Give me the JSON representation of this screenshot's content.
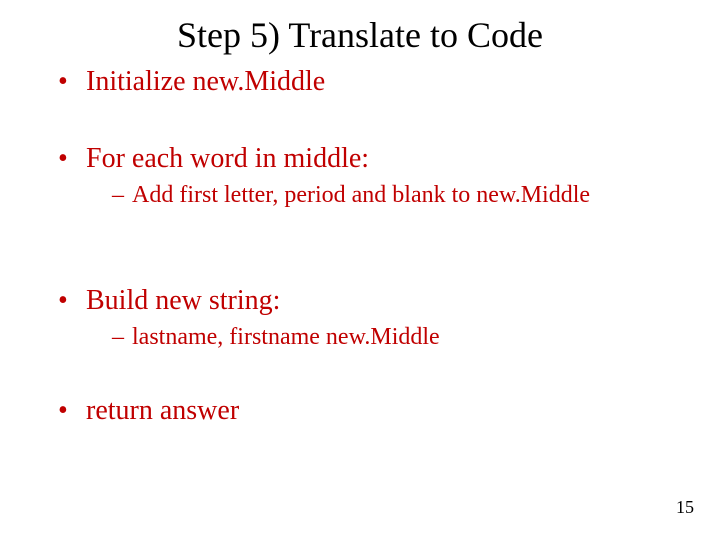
{
  "title": "Step 5) Translate to Code",
  "bullets": {
    "b1": "Initialize new.Middle",
    "b2": "For each word in middle:",
    "b2_sub1": "Add first letter, period and blank to new.Middle",
    "b3": "Build new string:",
    "b3_sub1": "lastname, firstname new.Middle",
    "b4": "return answer"
  },
  "page_number": "15"
}
